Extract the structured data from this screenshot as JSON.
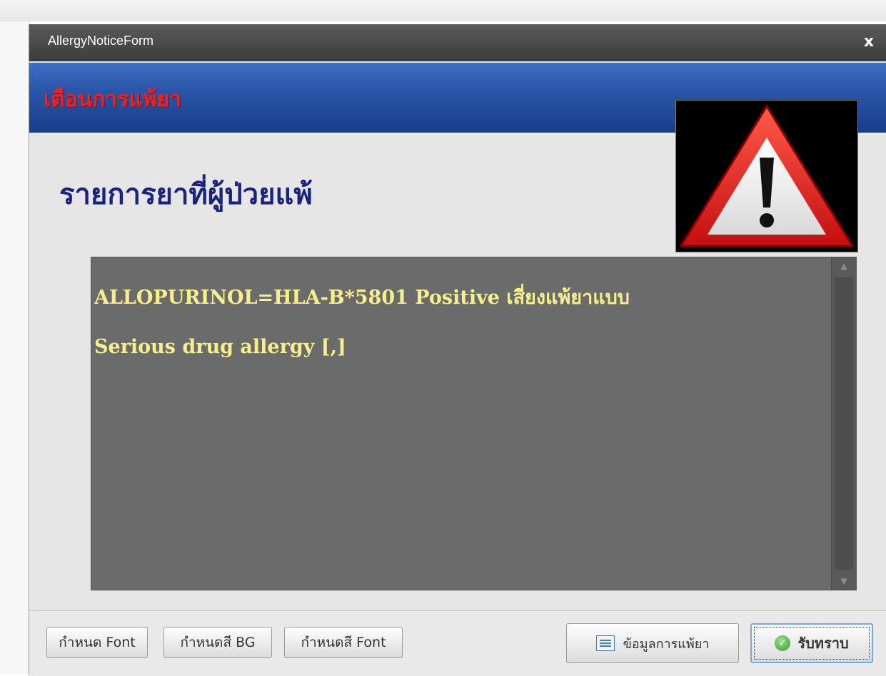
{
  "window": {
    "title": "AllergyNoticeForm",
    "close_label": "x"
  },
  "banner": {
    "title": "เตือนการแพ้ยา"
  },
  "section": {
    "title": "รายการยาที่ผู้ป่วยแพ้"
  },
  "message": {
    "lines": [
      "ALLOPURINOL=HLA-B*5801 Positive เสี่ยงแพ้ยาแบบ",
      "Serious drug allergy [,]"
    ]
  },
  "footer": {
    "set_font_label": "กำหนด Font",
    "set_bg_color_label": "กำหนดสี BG",
    "set_font_color_label": "กำหนดสี Font",
    "allergy_info_label": "ข้อมูลการแพ้ยา",
    "acknowledge_label": "รับทราบ"
  },
  "icons": {
    "warning": "warning-triangle-icon",
    "info": "list-icon",
    "check": "check-circle-icon"
  },
  "colors": {
    "banner_blue": "#2b55a8",
    "banner_title_red": "#e8242b",
    "section_title_navy": "#1a237e",
    "message_bg": "#6b6b6b",
    "message_text": "#f7f08a"
  }
}
